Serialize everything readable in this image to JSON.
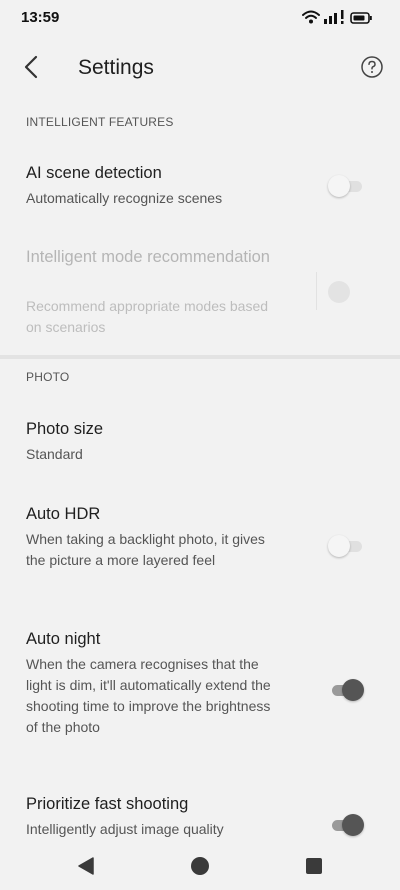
{
  "status_bar": {
    "time": "13:59",
    "icons": [
      "wifi-icon",
      "signal-icon",
      "battery-icon"
    ]
  },
  "header": {
    "title": "Settings",
    "back_icon": "chevron-left-icon",
    "help_icon": "help-circle-icon"
  },
  "sections": {
    "intelligent": {
      "label": "INTELLIGENT FEATURES",
      "items": [
        {
          "title": "AI scene detection",
          "description": "Automatically recognize scenes",
          "state": "off"
        },
        {
          "title": "Intelligent mode recommendation",
          "description": "Recommend appropriate modes based on scenarios",
          "state": "disabled"
        }
      ]
    },
    "photo": {
      "label": "PHOTO",
      "items": [
        {
          "title": "Photo size",
          "description": "Standard"
        },
        {
          "title": "Auto HDR",
          "description": "When taking a backlight photo, it gives the picture a more layered feel",
          "state": "off"
        },
        {
          "title": "Auto night",
          "description": "When the camera recognises that the light is dim, it'll automatically extend the shooting time to improve the brightness of the photo",
          "state": "on"
        },
        {
          "title": "Prioritize fast shooting",
          "description": "Intelligently adjust image quality",
          "state": "on"
        }
      ]
    }
  },
  "nav_bar": {
    "icons": [
      "back-triangle-icon",
      "home-circle-icon",
      "recents-square-icon"
    ]
  },
  "colors": {
    "background": "#f2f2f2",
    "toggle_on_knob": "#555555",
    "toggle_on_track": "#9a9a9a"
  }
}
